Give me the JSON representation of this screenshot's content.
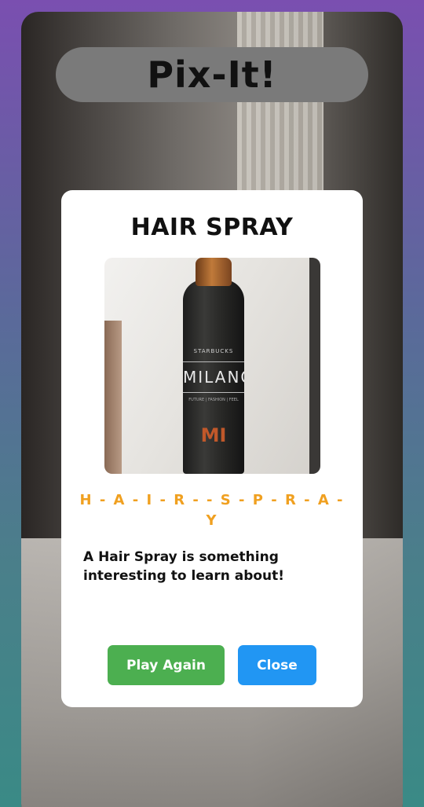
{
  "app": {
    "title": "Pix-It!"
  },
  "result_card": {
    "title": "HAIR SPRAY",
    "spelling": "H - A - I - R -  - S - P - R - A - Y",
    "description": "A Hair Spray is something interesting to learn about!",
    "photo": {
      "bottle_brand": "STARBUCKS",
      "bottle_label": "MILANO",
      "bottle_tagline": "FUTURE | FASHION | FEEL",
      "bottle_mark": "MI"
    },
    "buttons": {
      "play_again": "Play Again",
      "close": "Close"
    }
  },
  "colors": {
    "spelling": "#f0a020",
    "play_again": "#4caf50",
    "close": "#2196f3"
  }
}
